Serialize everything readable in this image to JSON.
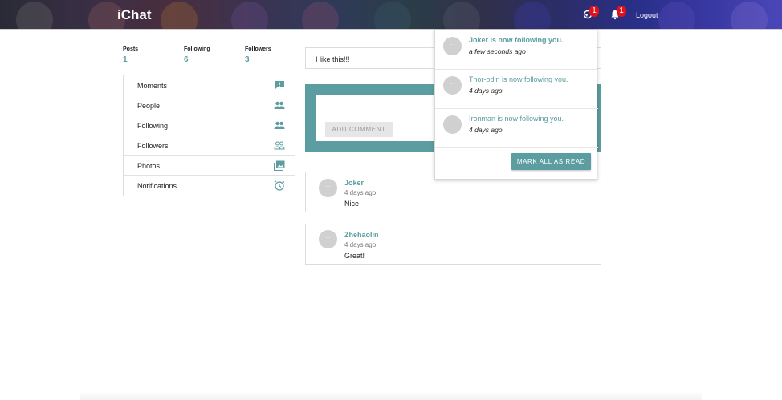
{
  "header": {
    "brand": "iChat",
    "logout_label": "Logout",
    "globe_badge": "1",
    "bell_badge": "1"
  },
  "stats": [
    {
      "label": "Posts",
      "value": "1"
    },
    {
      "label": "Following",
      "value": "6"
    },
    {
      "label": "Followers",
      "value": "3"
    }
  ],
  "menu": {
    "items": [
      {
        "label": "Moments",
        "icon": "feedback-icon"
      },
      {
        "label": "People",
        "icon": "people-icon"
      },
      {
        "label": "Following",
        "icon": "people-icon"
      },
      {
        "label": "Followers",
        "icon": "people-outline-icon"
      },
      {
        "label": "Photos",
        "icon": "photos-icon"
      },
      {
        "label": "Notifications",
        "icon": "alarm-icon"
      }
    ]
  },
  "post": {
    "text": "I like this!!!"
  },
  "comment_form": {
    "button_label": "ADD COMMENT"
  },
  "comments": [
    {
      "name": "Joker",
      "time": "4 days ago",
      "text": "Nice"
    },
    {
      "name": "Zhehaolin",
      "time": "4 days ago",
      "text": "Great!"
    }
  ],
  "notifications": {
    "items": [
      {
        "text": "Joker is now following you.",
        "time": "a few seconds ago",
        "unread": true
      },
      {
        "text": "Thor-odin is now following you.",
        "time": "4 days ago",
        "unread": false
      },
      {
        "text": "Ironman is now following you.",
        "time": "4 days ago",
        "unread": false
      }
    ],
    "mark_all_label": "MARK ALL AS READ"
  },
  "colors": {
    "accent": "#5b9da0",
    "badge": "#e0121e"
  }
}
